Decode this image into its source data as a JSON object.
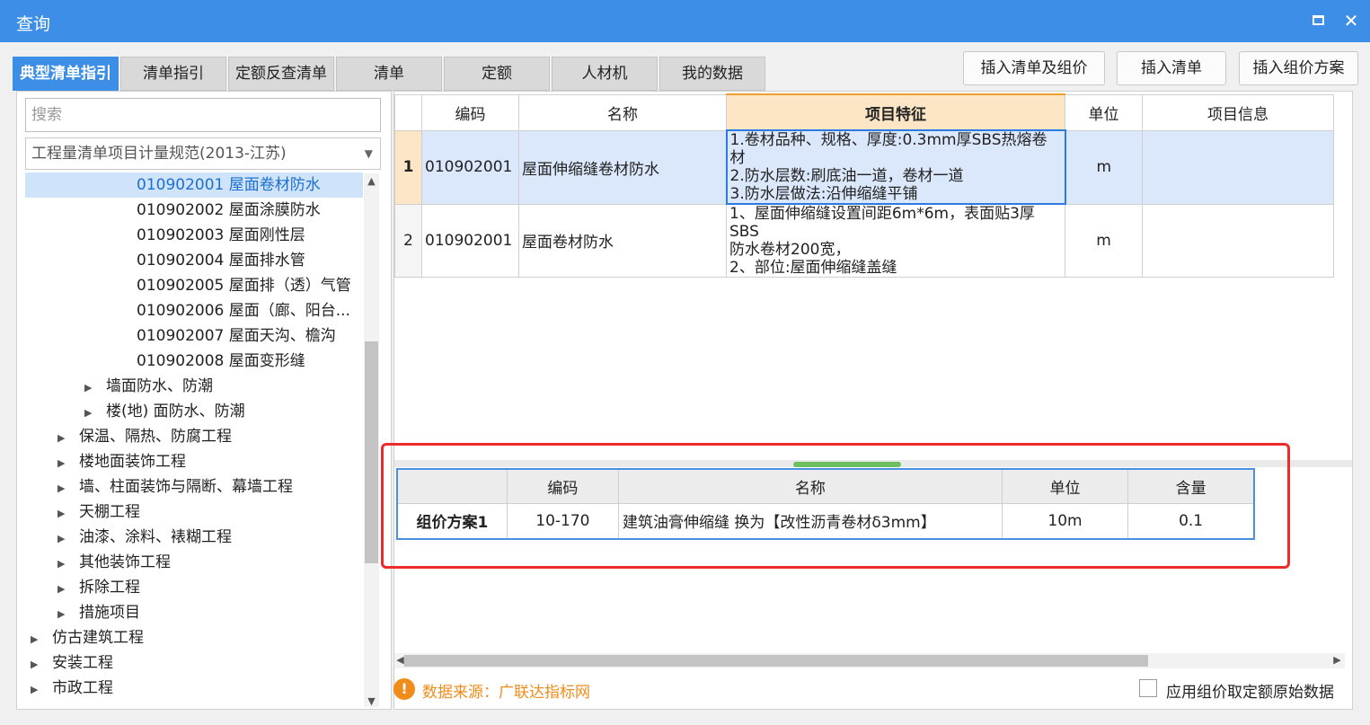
{
  "window": {
    "title": "查询"
  },
  "tabs": [
    "典型清单指引",
    "清单指引",
    "定额反查清单",
    "清单",
    "定额",
    "人材机",
    "我的数据"
  ],
  "actions": {
    "insert_list_price": "插入清单及组价",
    "insert_list": "插入清单",
    "insert_price_plan": "插入组价方案"
  },
  "left": {
    "search_placeholder": "搜索",
    "spec_select": "工程量清单项目计量规范(2013-江苏)",
    "tree": [
      {
        "label": "010902001 屋面卷材防水",
        "level": 3,
        "expander": false,
        "selected": true
      },
      {
        "label": "010902002 屋面涂膜防水",
        "level": 3,
        "expander": false
      },
      {
        "label": "010902003 屋面刚性层",
        "level": 3,
        "expander": false
      },
      {
        "label": "010902004 屋面排水管",
        "level": 3,
        "expander": false
      },
      {
        "label": "010902005 屋面排（透）气管",
        "level": 3,
        "expander": false
      },
      {
        "label": "010902006 屋面（廊、阳台...",
        "level": 3,
        "expander": false
      },
      {
        "label": "010902007 屋面天沟、檐沟",
        "level": 3,
        "expander": false
      },
      {
        "label": "010902008 屋面变形缝",
        "level": 3,
        "expander": false
      },
      {
        "label": "墙面防水、防潮",
        "level": 2,
        "expander": true
      },
      {
        "label": "楼(地) 面防水、防潮",
        "level": 2,
        "expander": true
      },
      {
        "label": "保温、隔热、防腐工程",
        "level": 1,
        "expander": true
      },
      {
        "label": "楼地面装饰工程",
        "level": 1,
        "expander": true
      },
      {
        "label": "墙、柱面装饰与隔断、幕墙工程",
        "level": 1,
        "expander": true
      },
      {
        "label": "天棚工程",
        "level": 1,
        "expander": true
      },
      {
        "label": "油漆、涂料、裱糊工程",
        "level": 1,
        "expander": true
      },
      {
        "label": "其他装饰工程",
        "level": 1,
        "expander": true
      },
      {
        "label": "拆除工程",
        "level": 1,
        "expander": true
      },
      {
        "label": "措施项目",
        "level": 1,
        "expander": true
      },
      {
        "label": "仿古建筑工程",
        "level": 0,
        "expander": true
      },
      {
        "label": "安装工程",
        "level": 0,
        "expander": true
      },
      {
        "label": "市政工程",
        "level": 0,
        "expander": true
      }
    ]
  },
  "grid": {
    "headers": {
      "code": "编码",
      "name": "名称",
      "feature": "项目特征",
      "unit": "单位",
      "info": "项目信息"
    },
    "rows": [
      {
        "num": "1",
        "code": "010902001",
        "name": "屋面伸缩缝卷材防水",
        "feature": [
          "1.卷材品种、规格、厚度:0.3mm厚SBS热熔卷材",
          "2.防水层数:刷底油一道，卷材一道",
          "3.防水层做法:沿伸缩缝平铺"
        ],
        "unit": "m",
        "info": ""
      },
      {
        "num": "2",
        "code": "010902001",
        "name": "屋面卷材防水",
        "feature": [
          "1、屋面伸缩缝设置间距6m*6m，表面贴3厚SBS",
          "防水卷材200宽，",
          "2、部位:屋面伸缩缝盖缝"
        ],
        "unit": "m",
        "info": ""
      }
    ]
  },
  "plan": {
    "headers": {
      "code": "编码",
      "name": "名称",
      "unit": "单位",
      "qty": "含量"
    },
    "row": {
      "label": "组价方案1",
      "code": "10-170",
      "name": "建筑油膏伸缩缝  换为【改性沥青卷材δ3mm】",
      "unit": "10m",
      "qty": "0.1"
    }
  },
  "footer": {
    "source": "数据来源：广联达指标网",
    "checkbox_label": "应用组价取定额原始数据"
  }
}
